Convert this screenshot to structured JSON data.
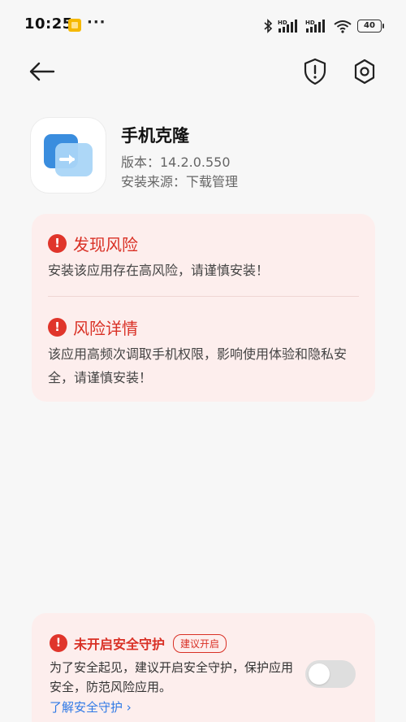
{
  "status_bar": {
    "time": "10:25",
    "more": "···",
    "notification_icon": "notes-app-icon",
    "signal1_label": "HD",
    "signal2_label": "HD",
    "battery": "40"
  },
  "title_bar": {
    "back_icon": "arrow-left-icon",
    "shield_icon": "shield-alert-icon",
    "settings_icon": "hexagon-gear-icon"
  },
  "app": {
    "name": "手机克隆",
    "version": "版本：14.2.0.550",
    "source": "安装来源：下载管理"
  },
  "risk": {
    "found_title": "发现风险",
    "found_text": "安装该应用存在高风险，请谨慎安装！",
    "detail_title": "风险详情",
    "detail_text": "该应用高频次调取手机权限，影响使用体验和隐私安全，请谨慎安装！"
  },
  "security": {
    "title": "未开启安全守护",
    "badge": "建议开启",
    "description": "为了安全起见，建议开启安全守护，保护应用安全，防范风险应用。",
    "link": "了解安全守护 ›",
    "toggle_on": false
  },
  "colors": {
    "danger": "#d93025",
    "card_bg": "#fdeeed",
    "link": "#2f79e6",
    "page_bg": "#f7f7f7"
  }
}
